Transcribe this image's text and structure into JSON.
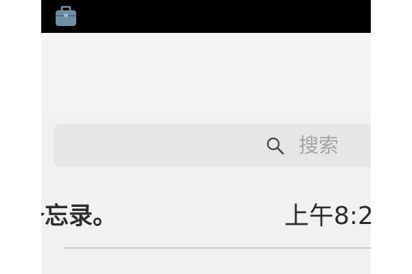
{
  "status_bar": {
    "icons": [
      "briefcase-icon"
    ]
  },
  "search": {
    "icon": "search-icon",
    "placeholder": "搜索"
  },
  "note": {
    "title_fragment": "备忘录。",
    "time_fragment": "上午8:2"
  },
  "colors": {
    "status_bar_bg": "#000000",
    "page_bg": "#f1f1f1",
    "search_bg": "#e6e6e6",
    "placeholder_text": "#a4a4a4",
    "primary_text": "#2d2d2d",
    "divider": "#c8c8c8"
  }
}
